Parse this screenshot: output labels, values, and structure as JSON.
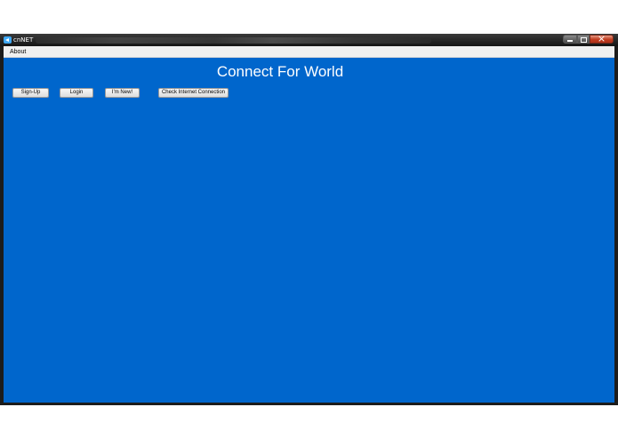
{
  "window": {
    "title": "cnNET"
  },
  "menu": {
    "items": [
      "About"
    ]
  },
  "main": {
    "heading": "Connect For World",
    "buttons": {
      "signup": "Sign-Up",
      "login": "Login",
      "new": "I'm New!",
      "check": "Check Internet Connection"
    }
  },
  "colors": {
    "background": "#0066cc",
    "titlebar": "#1c1c1c",
    "menubar": "#f0f0f0"
  }
}
